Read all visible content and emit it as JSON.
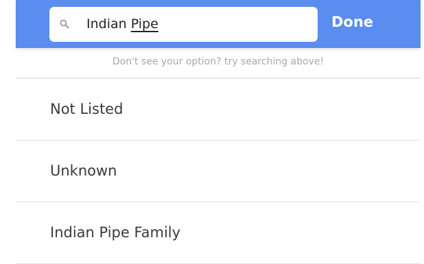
{
  "search": {
    "value_prefix": "Indian ",
    "value_underlined": "Pipe",
    "icon": "search-icon"
  },
  "header": {
    "done_label": "Done",
    "accent_color": "#5b8def"
  },
  "hint": "Don't see your option? try searching above!",
  "options": [
    {
      "label": "Not Listed"
    },
    {
      "label": "Unknown"
    },
    {
      "label": "Indian Pipe Family"
    }
  ]
}
